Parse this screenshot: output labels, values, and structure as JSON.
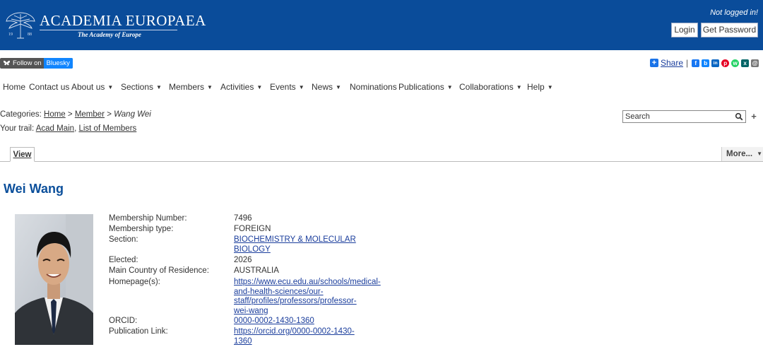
{
  "header": {
    "logo_name": "ACADEMIA EUROPAEA",
    "logo_sub": "The Academy of Europe",
    "logo_year_left": "19",
    "logo_year_right": "88",
    "status": "Not logged in!",
    "login_label": "Login",
    "get_password_label": "Get Password",
    "bg_color": "#0a4c9a"
  },
  "social": {
    "bluesky_prefix": "Follow on",
    "bluesky_name": "Bluesky",
    "share_label": "Share",
    "share_sep": "|",
    "share_icons": [
      {
        "name": "facebook-icon",
        "color": "#1877f2",
        "glyph": "f"
      },
      {
        "name": "bluesky-icon",
        "color": "#1185fe",
        "glyph": "b"
      },
      {
        "name": "linkedin-icon",
        "color": "#0a66c2",
        "glyph": "in"
      },
      {
        "name": "pinterest-icon",
        "color": "#e60023",
        "glyph": "p"
      },
      {
        "name": "whatsapp-icon",
        "color": "#25d366",
        "glyph": "w"
      },
      {
        "name": "xing-icon",
        "color": "#026466",
        "glyph": "x"
      },
      {
        "name": "email-icon",
        "color": "#777777",
        "glyph": "@"
      }
    ]
  },
  "nav": {
    "items": [
      {
        "label": "Home",
        "caret": false
      },
      {
        "label": "Contact us",
        "caret": false
      },
      {
        "label": "About us",
        "caret": true
      },
      {
        "label": "Sections",
        "caret": true
      },
      {
        "label": "Members",
        "caret": true
      },
      {
        "label": "Activities",
        "caret": true
      },
      {
        "label": "Events",
        "caret": true
      },
      {
        "label": "News",
        "caret": true
      },
      {
        "label": "Nominations",
        "caret": false
      },
      {
        "label": "Publications",
        "caret": true
      },
      {
        "label": "Collaborations",
        "caret": true
      },
      {
        "label": "Help",
        "caret": true
      }
    ],
    "caret_glyph": "▼"
  },
  "categories": {
    "prefix": "Categories:",
    "home": "Home",
    "sep": ">",
    "member": "Member",
    "current": "Wang Wei"
  },
  "trail": {
    "prefix": "Your trail:",
    "acad_main": "Acad Main",
    "comma": ",",
    "list_of_members": "List of Members"
  },
  "search": {
    "placeholder": "Search",
    "plus": "+"
  },
  "tabs": {
    "view": "View",
    "more": "More...",
    "more_caret": "▼"
  },
  "profile": {
    "name": "Wei Wang",
    "membership_number_label": "Membership Number:",
    "membership_number": "7496",
    "membership_type_label": "Membership type:",
    "membership_type": "FOREIGN",
    "section_label": "Section:",
    "section_line1": "BIOCHEMISTRY & MOLECULAR",
    "section_line2": "BIOLOGY",
    "elected_label": "Elected:",
    "elected": "2026",
    "country_label": "Main Country of Residence:",
    "country": "AUSTRALIA",
    "homepage_label": "Homepage(s):",
    "homepage_line1": "https://www.ecu.edu.au/schools/medical-",
    "homepage_line2": "and-health-sciences/our-",
    "homepage_line3": "staff/profiles/professors/professor-",
    "homepage_line4": "wei-wang",
    "orcid_label": "ORCID:",
    "orcid": "0000-0002-1430-1360",
    "publication_label": "Publication Link:",
    "publication_line1": "https://orcid.org/0000-0002-1430-",
    "publication_line2": "1360"
  }
}
